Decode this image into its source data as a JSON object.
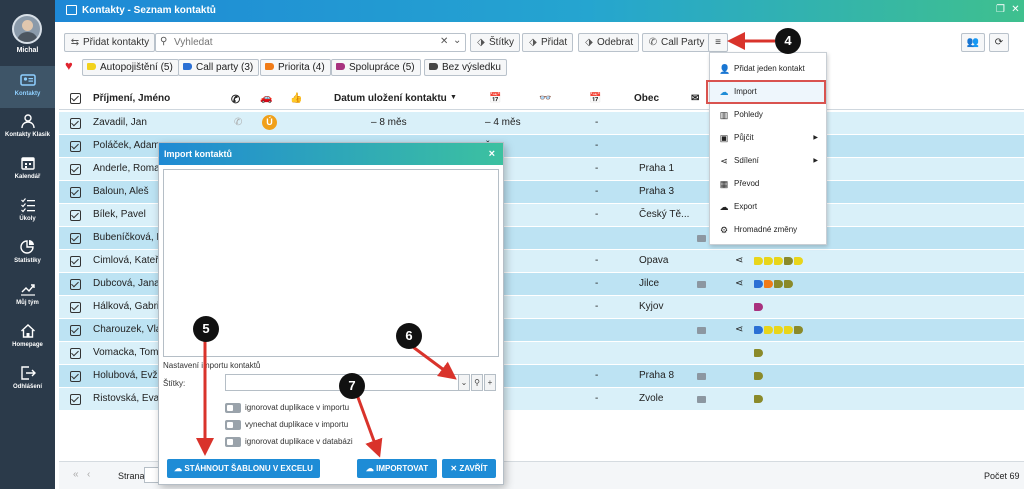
{
  "user": {
    "name": "Michal"
  },
  "sidebar": {
    "items": [
      {
        "label": "Kontakty",
        "icon": "contacts-icon",
        "active": true
      },
      {
        "label": "Kontakty Klasik",
        "icon": "person-icon"
      },
      {
        "label": "Kalendář",
        "icon": "calendar-icon"
      },
      {
        "label": "Úkoly",
        "icon": "tasks-icon"
      },
      {
        "label": "Statistiky",
        "icon": "pie-chart-icon"
      },
      {
        "label": "Můj tým",
        "icon": "trend-icon"
      },
      {
        "label": "Homepage",
        "icon": "home-icon"
      },
      {
        "label": "Odhlášení",
        "icon": "logout-icon"
      }
    ]
  },
  "window": {
    "title": "Kontakty - Seznam kontaktů"
  },
  "toolbar": {
    "add_contacts": "Přidat kontakty",
    "search_placeholder": "Vyhledat",
    "tags": "Štítky",
    "add": "Přidat",
    "remove": "Odebrat",
    "call_party": "Call Party"
  },
  "filters": [
    {
      "label": "Autopojištění (5)",
      "color": "#f2d21b"
    },
    {
      "label": "Call party (3)",
      "color": "#2a6fd4"
    },
    {
      "label": "Priorita (4)",
      "color": "#f07b17"
    },
    {
      "label": "Spolupráce (5)",
      "color": "#a8327f"
    },
    {
      "label": "Bez výsledku",
      "color": "#444444"
    }
  ],
  "table": {
    "headers": {
      "name": "Příjmení, Jméno",
      "date_saved": "Datum uložení kontaktu",
      "city": "Obec"
    },
    "rows": [
      {
        "name": "Zavadil, Jan",
        "saved": "– 8 měs",
        "last": "– 4 měs",
        "dash": "-",
        "city": "",
        "badge": "Ú",
        "env": false,
        "share": false,
        "tags": []
      },
      {
        "name": "Poláček, Adam",
        "saved": "",
        "last": "ěs",
        "dash": "-",
        "city": "",
        "env": false,
        "share": false,
        "tags": []
      },
      {
        "name": "Anderle, Roma",
        "saved": "",
        "last": "ěs",
        "dash": "-",
        "city": "Praha 1",
        "env": false,
        "share": false,
        "tags": []
      },
      {
        "name": "Baloun, Aleš",
        "saved": "",
        "last": "t",
        "dash": "-",
        "city": "Praha 3",
        "env": false,
        "share": false,
        "tags": []
      },
      {
        "name": "Bílek, Pavel",
        "saved": "",
        "last": "ěs",
        "dash": "-",
        "city": "Český Tě...",
        "env": false,
        "share": false,
        "tags": []
      },
      {
        "name": "Bubeníčková, I",
        "saved": "",
        "last": "ěs",
        "dash": "",
        "city": "",
        "env": true,
        "share": true,
        "tags": [
          "#e8d51a",
          "#2e9e3c",
          "#a8327f",
          "#8a8a2a"
        ]
      },
      {
        "name": "Cimlová, Kateř",
        "saved": "",
        "last": "t",
        "dash": "-",
        "city": "Opava",
        "env": false,
        "share": true,
        "tags": [
          "#e8d51a",
          "#e8d51a",
          "#e8d51a",
          "#8a8a2a",
          "#e8d51a"
        ]
      },
      {
        "name": "Dubcová, Jana",
        "saved": "",
        "last": "ěs",
        "dash": "-",
        "city": "Jilce",
        "env": true,
        "share": true,
        "tags": [
          "#2a6fd4",
          "#f07b17",
          "#8a8a2a",
          "#8a8a2a"
        ]
      },
      {
        "name": "Hálková, Gabri",
        "saved": "",
        "last": "ěs",
        "dash": "-",
        "city": "Kyjov",
        "env": false,
        "share": false,
        "tags": [
          "#a8327f"
        ]
      },
      {
        "name": "Charouzek, Vla",
        "saved": "",
        "last": "ěs",
        "dash": "",
        "city": "",
        "env": true,
        "share": true,
        "tags": [
          "#2a6fd4",
          "#e8d51a",
          "#e8d51a",
          "#e8d51a",
          "#8a8a2a"
        ]
      },
      {
        "name": "Vomacka, Tom",
        "saved": "",
        "last": "",
        "dash": "",
        "city": "",
        "env": false,
        "share": false,
        "tags": [
          "#8a8a2a"
        ]
      },
      {
        "name": "Holubová, Evž",
        "saved": "",
        "last": "t",
        "dash": "-",
        "city": "Praha 8",
        "env": true,
        "share": false,
        "tags": [
          "#8a8a2a"
        ]
      },
      {
        "name": "Ristovská, Eva",
        "saved": "",
        "last": "ěs",
        "dash": "-",
        "city": "Zvole",
        "env": true,
        "share": false,
        "tags": [
          "#8a8a2a"
        ]
      }
    ]
  },
  "pager": {
    "page_label": "Strana",
    "count": "Počet 69"
  },
  "menu": {
    "items": [
      {
        "label": "Přidat jeden kontakt",
        "icon": "add-user-icon"
      },
      {
        "label": "Import",
        "icon": "cloud-upload-icon",
        "highlighted": true
      },
      {
        "label": "Pohledy",
        "icon": "columns-icon"
      },
      {
        "label": "Půjčit",
        "icon": "briefcase-icon",
        "submenu": true
      },
      {
        "label": "Sdílení",
        "icon": "share-icon",
        "submenu": true
      },
      {
        "label": "Převod",
        "icon": "gift-icon"
      },
      {
        "label": "Export",
        "icon": "cloud-download-icon"
      },
      {
        "label": "Hromadné změny",
        "icon": "cogs-icon"
      }
    ]
  },
  "dialog": {
    "title": "Import kontaktů",
    "settings_label": "Nastavení importu kontaktů",
    "tags_label": "Štítky:",
    "options": [
      "ignorovat duplikace v importu",
      "vynechat duplikace v importu",
      "ignorovat duplikace v databázi"
    ],
    "download_template": "STÁHNOUT ŠABLONU V EXCELU",
    "import": "IMPORTOVAT",
    "close": "ZAVŘÍT"
  },
  "markers": [
    "4",
    "5",
    "6",
    "7"
  ]
}
